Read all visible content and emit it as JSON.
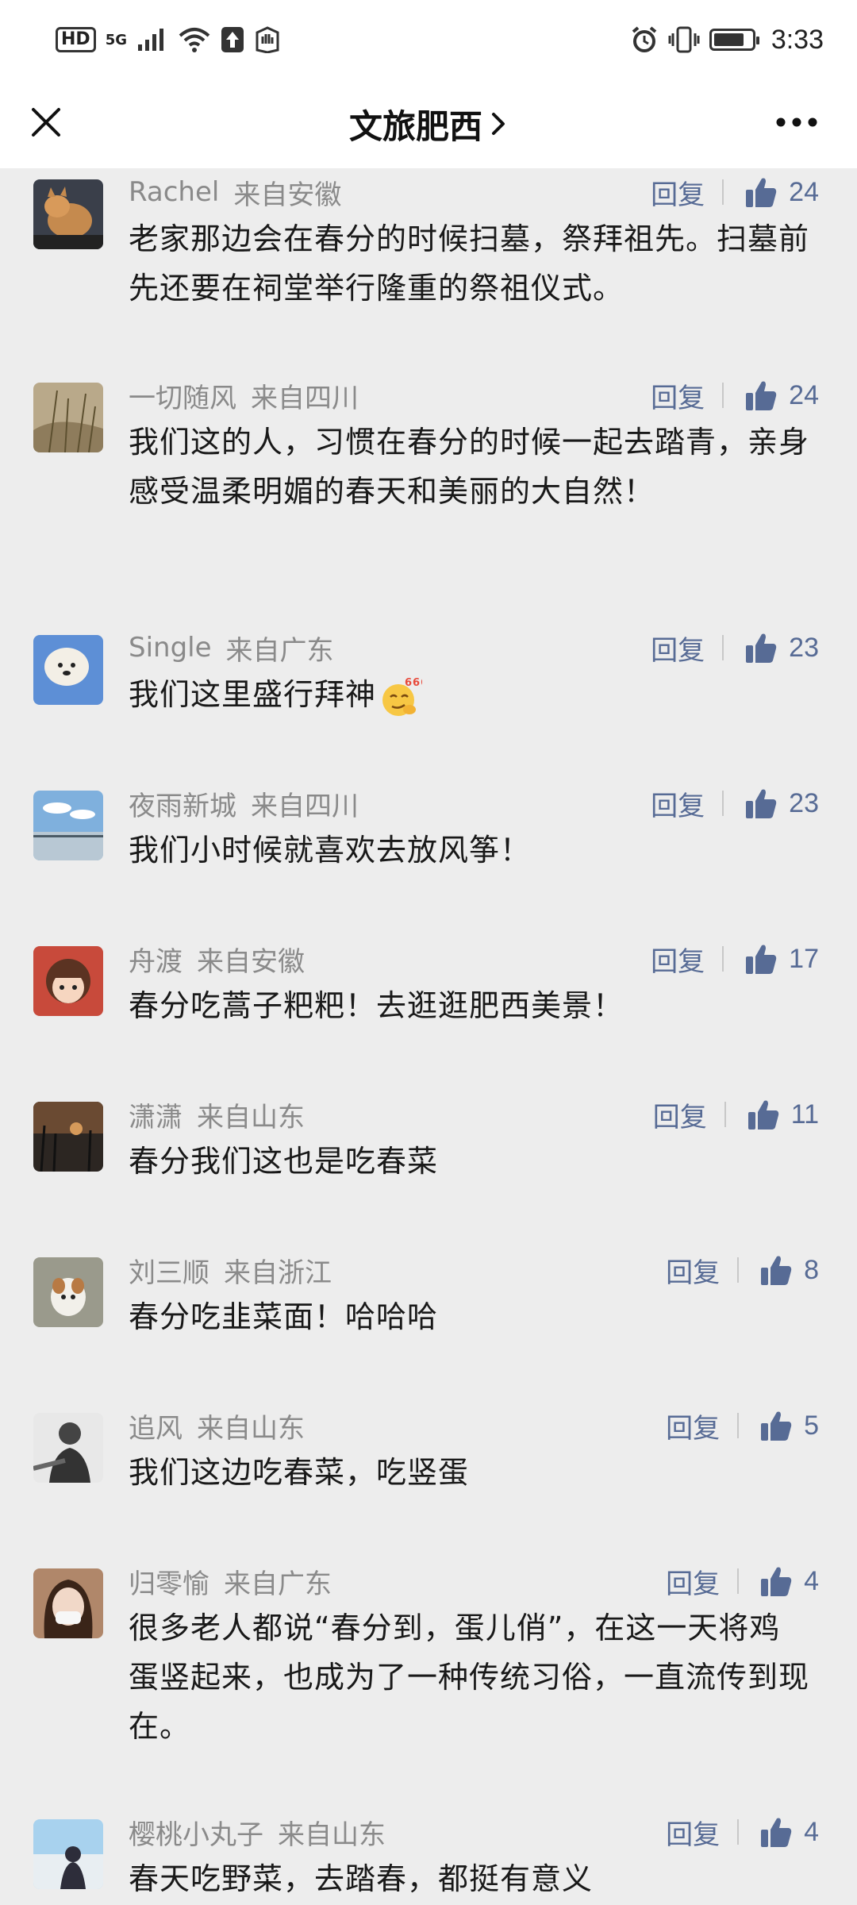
{
  "status_bar": {
    "hd": "HD",
    "network": "5G",
    "time": "3:33",
    "battery_level": 0.8
  },
  "header": {
    "title": "文旅肥西",
    "chevron": "›",
    "close_icon": "close-icon",
    "more_icon": "more-icon"
  },
  "colors": {
    "link": "#576b95",
    "meta": "#8a8a8a",
    "background": "#ededed"
  },
  "reply_label": "回复",
  "comments": [
    {
      "name": "Rachel",
      "region": "来自安徽",
      "reply": "回复",
      "likes": "24",
      "text": "老家那边会在春分的时候扫墓，祭拜祖先。扫墓前先还要在祠堂举行隆重的祭祖仪式。"
    },
    {
      "name": "一切随风",
      "region": "来自四川",
      "reply": "回复",
      "likes": "24",
      "text": "我们这的人，习惯在春分的时候一起去踏青，亲身感受温柔明媚的春天和美丽的大自然！"
    },
    {
      "name": "Single",
      "region": "来自广东",
      "reply": "回复",
      "likes": "23",
      "text": "我们这里盛行拜神",
      "emoji": "666-emoji"
    },
    {
      "name": "夜雨新城",
      "region": "来自四川",
      "reply": "回复",
      "likes": "23",
      "text": "我们小时候就喜欢去放风筝！"
    },
    {
      "name": "舟渡",
      "region": "来自安徽",
      "reply": "回复",
      "likes": "17",
      "text": "春分吃蒿子粑粑！去逛逛肥西美景！"
    },
    {
      "name": "潇潇",
      "region": "来自山东",
      "reply": "回复",
      "likes": "11",
      "text": "春分我们这也是吃春菜"
    },
    {
      "name": "刘三顺",
      "region": "来自浙江",
      "reply": "回复",
      "likes": "8",
      "text": "春分吃韭菜面！哈哈哈"
    },
    {
      "name": "追风",
      "region": "来自山东",
      "reply": "回复",
      "likes": "5",
      "text": "我们这边吃春菜，吃竖蛋"
    },
    {
      "name": "归零愉",
      "region": "来自广东",
      "reply": "回复",
      "likes": "4",
      "text": "很多老人都说“春分到，蛋儿俏”，在这一天将鸡蛋竖起来，也成为了一种传统习俗，一直流传到现在。"
    },
    {
      "name": "樱桃小丸子",
      "region": "来自山东",
      "reply": "回复",
      "likes": "4",
      "text": "春天吃野菜，去踏春，都挺有意义"
    }
  ]
}
